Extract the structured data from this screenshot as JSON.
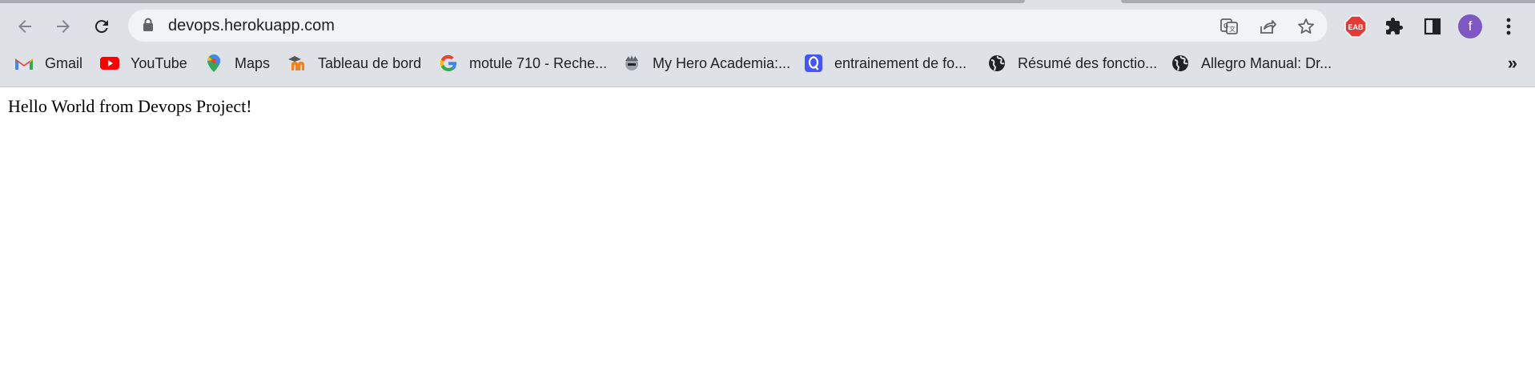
{
  "browser": {
    "url": "devops.herokuapp.com",
    "profile_initial": "f",
    "extension_badge": "EAB"
  },
  "bookmarks": [
    {
      "label": "Gmail",
      "icon": "gmail-icon"
    },
    {
      "label": "YouTube",
      "icon": "youtube-icon"
    },
    {
      "label": "Maps",
      "icon": "maps-icon"
    },
    {
      "label": "Tableau de bord",
      "icon": "moodle-icon"
    },
    {
      "label": "motule 710 - Reche...",
      "icon": "google-icon"
    },
    {
      "label": "My Hero Academia:...",
      "icon": "anime-icon"
    },
    {
      "label": "entrainement de fo...",
      "icon": "quizlet-icon"
    },
    {
      "label": "Résumé des fonctio...",
      "icon": "globe-icon"
    },
    {
      "label": "Allegro Manual: Dr...",
      "icon": "globe-icon"
    }
  ],
  "bookmarks_overflow": "»",
  "page": {
    "body_text": "Hello World from Devops Project!"
  },
  "colors": {
    "chrome_bg": "#dee1e6",
    "omnibox_bg": "#f1f3f4",
    "profile": "#7e57c2",
    "youtube": "#ff0000",
    "quizlet": "#4255ff"
  }
}
